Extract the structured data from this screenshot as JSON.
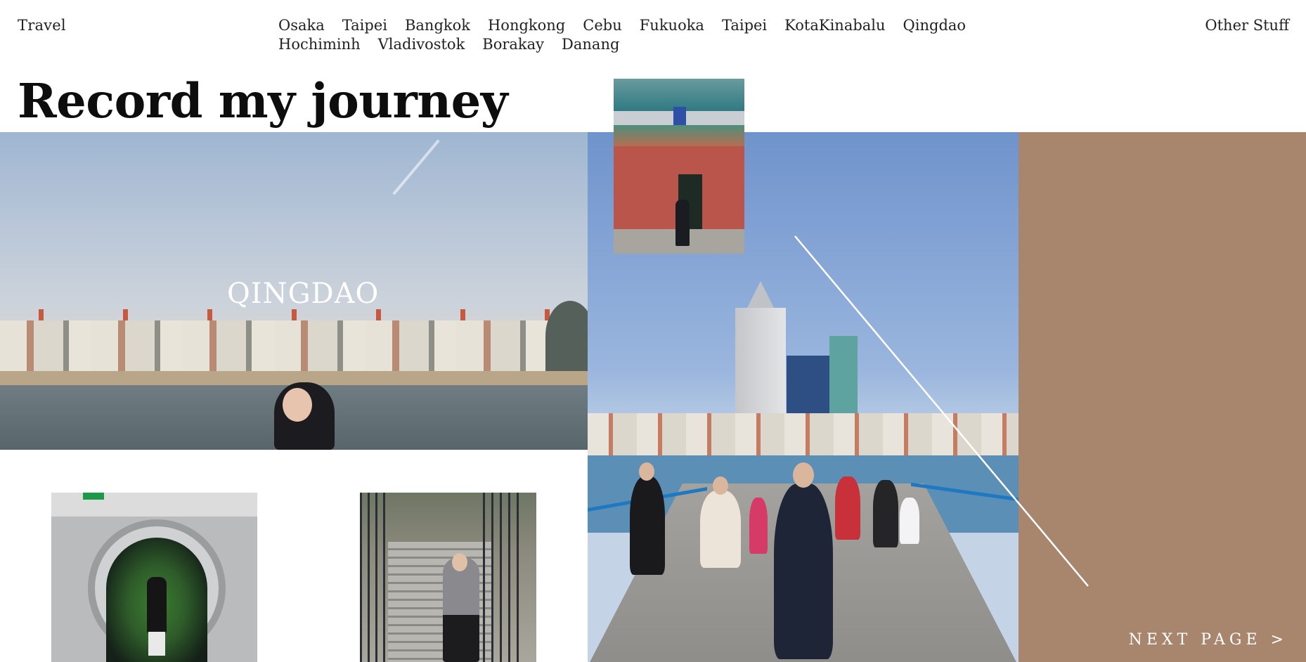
{
  "header": {
    "brand": "Travel",
    "nav": [
      "Osaka",
      "Taipei",
      "Bangkok",
      "Hongkong",
      "Cebu",
      "Fukuoka",
      "Taipei",
      "KotaKinabalu",
      "Qingdao",
      "Hochiminh",
      "Vladivostok",
      "Borakay",
      "Danang"
    ],
    "other_link": "Other Stuff"
  },
  "page": {
    "title": "Record my journey",
    "hero_caption": "QINGDAO",
    "next_link": "NEXT PAGE >"
  },
  "colors": {
    "panel": "#a8866d",
    "text": "#1a1a1a",
    "background": "#ffffff"
  }
}
